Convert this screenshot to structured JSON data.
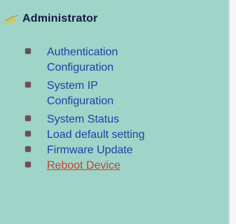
{
  "section": {
    "title": "Administrator",
    "icon": "arrow-icon"
  },
  "menu": {
    "items": [
      {
        "label": "Authentication Configuration",
        "active": false
      },
      {
        "label": "System IP Configuration",
        "active": false
      },
      {
        "label": "System Status",
        "active": false
      },
      {
        "label": "Load default setting",
        "active": false
      },
      {
        "label": "Firmware Update",
        "active": false
      },
      {
        "label": "Reboot Device",
        "active": true
      }
    ]
  },
  "colors": {
    "panel_bg": "#9fd4c8",
    "link": "#1f3fa8",
    "active_link": "#c8402e",
    "title": "#111a40",
    "bullet": "#6a4f59"
  }
}
